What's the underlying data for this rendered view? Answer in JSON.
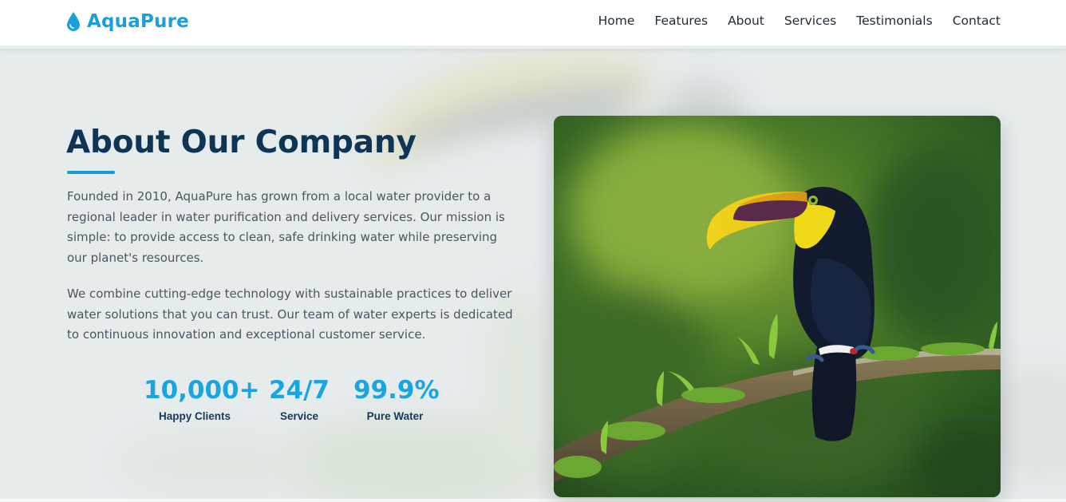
{
  "brand": {
    "name": "AquaPure",
    "icon": "water-drop-icon",
    "color": "#1aa0d8"
  },
  "nav": {
    "items": [
      {
        "label": "Home"
      },
      {
        "label": "Features"
      },
      {
        "label": "About"
      },
      {
        "label": "Services"
      },
      {
        "label": "Testimonials"
      },
      {
        "label": "Contact"
      }
    ]
  },
  "about": {
    "title": "About Our Company",
    "paragraphs": [
      "Founded in 2010, AquaPure has grown from a local water provider to a regional leader in water purification and delivery services. Our mission is simple: to provide access to clean, safe drinking water while preserving our planet's resources.",
      "We combine cutting-edge technology with sustainable practices to deliver water solutions that you can trust. Our team of water experts is dedicated to continuous innovation and exceptional customer service."
    ],
    "stats": [
      {
        "value": "10,000+",
        "label": "Happy Clients"
      },
      {
        "value": "24/7",
        "label": "Service"
      },
      {
        "value": "99.9%",
        "label": "Pure Water"
      }
    ],
    "image": {
      "subject": "toucan-on-branch"
    }
  },
  "colors": {
    "title": "#0e3556",
    "accent": "#1a9ad6",
    "stat_value": "#18a5e0",
    "stat_label": "#163a5e",
    "body_text": "#4b5661"
  }
}
